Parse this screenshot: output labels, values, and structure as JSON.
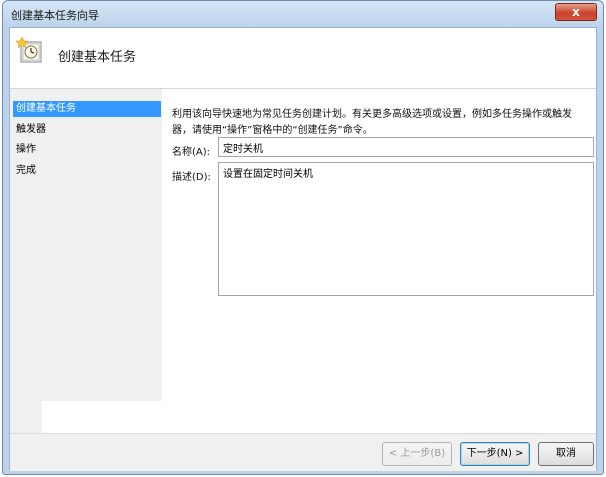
{
  "window": {
    "title": "创建基本任务向导",
    "close_glyph": "x"
  },
  "header": {
    "icon": "task-clock-icon",
    "title": "创建基本任务"
  },
  "sidebar": {
    "items": [
      {
        "label": "创建基本任务",
        "active": true
      },
      {
        "label": "触发器",
        "active": false
      },
      {
        "label": "操作",
        "active": false
      },
      {
        "label": "完成",
        "active": false
      }
    ]
  },
  "main": {
    "description_line1": "利用该向导快速地为常见任务创建计划。有关更多高级选项或设置，例如多任务操作或触发",
    "description_line2": "器，请使用“操作”窗格中的“创建任务”命令。",
    "name_label": "名称(A):",
    "name_value": "定时关机",
    "description_label": "描述(D):",
    "description_value": "设置在固定时间关机"
  },
  "footer": {
    "back_label": "< 上一步(B)",
    "next_label": "下一步(N) >",
    "cancel_label": "取消"
  },
  "colors": {
    "accent": "#3399ff",
    "titlebar": "#bcd3ea",
    "close": "#c7442b"
  }
}
